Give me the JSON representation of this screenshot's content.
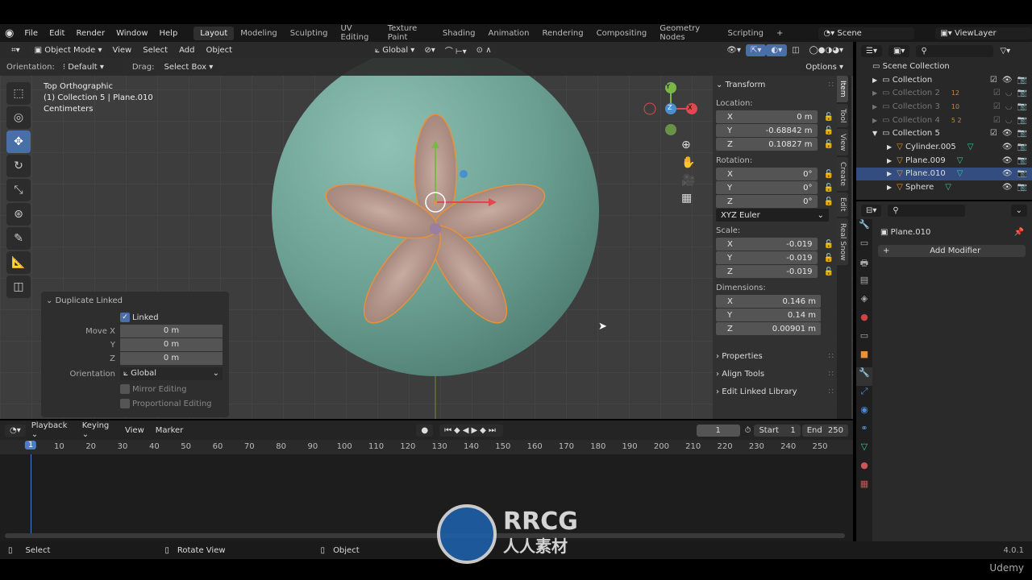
{
  "topbar": {
    "menus": [
      "File",
      "Edit",
      "Render",
      "Window",
      "Help"
    ],
    "workspaces": [
      "Layout",
      "Modeling",
      "Sculpting",
      "UV Editing",
      "Texture Paint",
      "Shading",
      "Animation",
      "Rendering",
      "Compositing",
      "Geometry Nodes",
      "Scripting"
    ],
    "active_workspace": "Layout",
    "add_workspace": "+",
    "scene": "Scene",
    "view_layer": "ViewLayer"
  },
  "viewport_header": {
    "mode": "Object Mode",
    "menus": [
      "View",
      "Select",
      "Add",
      "Object"
    ],
    "transform_orientation": "Global",
    "options": "Options"
  },
  "tool_settings": {
    "orientation_label": "Orientation:",
    "orientation": "Default",
    "drag_label": "Drag:",
    "drag": "Select Box"
  },
  "overlay_text": {
    "view": "Top Orthographic",
    "object": "(1) Collection 5 | Plane.010",
    "units": "Centimeters"
  },
  "gizmo": {
    "x": "X",
    "y": "Y",
    "z": "Z"
  },
  "npanel": {
    "transform": "Transform",
    "location_label": "Location:",
    "location": [
      {
        "axis": "X",
        "value": "0 m"
      },
      {
        "axis": "Y",
        "value": "-0.68842 m"
      },
      {
        "axis": "Z",
        "value": "0.10827 m"
      }
    ],
    "rotation_label": "Rotation:",
    "rotation": [
      {
        "axis": "X",
        "value": "0°"
      },
      {
        "axis": "Y",
        "value": "0°"
      },
      {
        "axis": "Z",
        "value": "0°"
      }
    ],
    "rotation_mode": "XYZ Euler",
    "scale_label": "Scale:",
    "scale": [
      {
        "axis": "X",
        "value": "-0.019"
      },
      {
        "axis": "Y",
        "value": "-0.019"
      },
      {
        "axis": "Z",
        "value": "-0.019"
      }
    ],
    "dimensions_label": "Dimensions:",
    "dimensions": [
      {
        "axis": "X",
        "value": "0.146 m"
      },
      {
        "axis": "Y",
        "value": "0.14 m"
      },
      {
        "axis": "Z",
        "value": "0.00901 m"
      }
    ],
    "sections": [
      "Properties",
      "Align Tools",
      "Edit Linked Library"
    ],
    "tabs": [
      "Item",
      "Tool",
      "View",
      "Create",
      "Edit",
      "Real Snow"
    ]
  },
  "redo_panel": {
    "title": "Duplicate Linked",
    "linked": "Linked",
    "linked_checked": true,
    "move_x_label": "Move X",
    "y_label": "Y",
    "z_label": "Z",
    "move": [
      "0 m",
      "0 m",
      "0 m"
    ],
    "orientation_label": "Orientation",
    "orientation": "Global",
    "mirror": "Mirror Editing",
    "proportional": "Proportional Editing"
  },
  "timeline": {
    "menus": [
      "Playback",
      "Keying",
      "View",
      "Marker"
    ],
    "current_frame": "1",
    "start_label": "Start",
    "start": "1",
    "end_label": "End",
    "end": "250",
    "ticks": [
      "1",
      "10",
      "20",
      "30",
      "40",
      "50",
      "60",
      "70",
      "80",
      "90",
      "100",
      "110",
      "120",
      "130",
      "140",
      "150",
      "160",
      "170",
      "180",
      "190",
      "200",
      "210",
      "220",
      "230",
      "240",
      "250"
    ]
  },
  "outliner": {
    "scene_collection": "Scene Collection",
    "rows": [
      {
        "name": "Collection",
        "dim": false,
        "badge": ""
      },
      {
        "name": "Collection 2",
        "dim": true,
        "badge": "12"
      },
      {
        "name": "Collection 3",
        "dim": true,
        "badge": "10"
      },
      {
        "name": "Collection 4",
        "dim": true,
        "badge": "5 2"
      },
      {
        "name": "Collection 5",
        "dim": false,
        "badge": ""
      },
      {
        "name": "Cylinder.005",
        "dim": false,
        "badge": ""
      },
      {
        "name": "Plane.009",
        "dim": false,
        "badge": ""
      },
      {
        "name": "Plane.010",
        "dim": false,
        "badge": "",
        "selected": true
      },
      {
        "name": "Sphere",
        "dim": false,
        "badge": ""
      }
    ]
  },
  "properties": {
    "object": "Plane.010",
    "add_modifier": "Add Modifier"
  },
  "status": {
    "select": "Select",
    "rotate": "Rotate View",
    "object": "Object",
    "version": "4.0.1"
  },
  "watermark": {
    "logo": "RRCG",
    "sub": "人人素材",
    "udemy": "Udemy"
  },
  "colors": {
    "accent": "#4a6fa8",
    "sphere": "#6fa597",
    "petal": "#b89a8f",
    "selection": "#e8913a"
  }
}
